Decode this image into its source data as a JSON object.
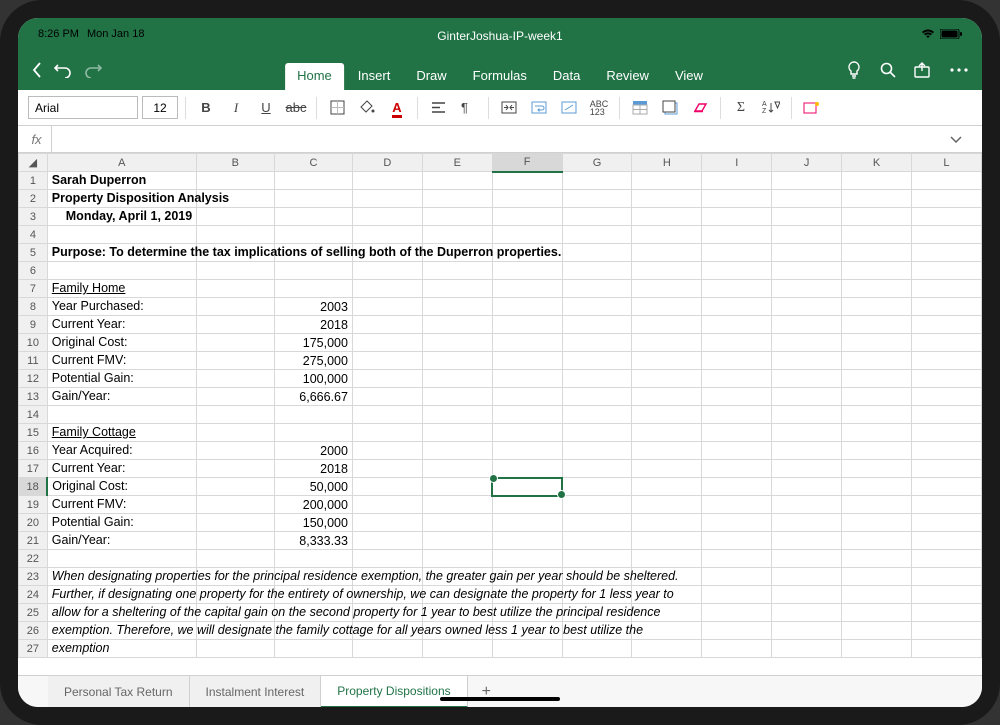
{
  "status": {
    "time": "8:26 PM",
    "date": "Mon Jan 18"
  },
  "file_title": "GinterJoshua-IP-week1",
  "ribbon": {
    "tabs": [
      "Home",
      "Insert",
      "Draw",
      "Formulas",
      "Data",
      "Review",
      "View"
    ],
    "active_index": 0
  },
  "toolbar": {
    "font_name": "Arial",
    "font_size": "12"
  },
  "formula": {
    "fx": "fx",
    "value": ""
  },
  "columns": [
    "A",
    "B",
    "C",
    "D",
    "E",
    "F",
    "G",
    "H",
    "I",
    "J",
    "K",
    "L"
  ],
  "active_col": "F",
  "active_row": 18,
  "rows": {
    "1": {
      "A": "Sarah Duperron",
      "bold": true
    },
    "2": {
      "A": "Property Disposition Analysis",
      "bold": true
    },
    "3": {
      "A_text": "Monday, April 1, 2019",
      "A_indent": true,
      "bold": true
    },
    "5": {
      "A": "Purpose: To determine the tax implications of selling both of the Duperron properties.",
      "bold": true
    },
    "7": {
      "A": "Family Home",
      "underline": true
    },
    "8": {
      "A": "Year Purchased:",
      "C": "2003"
    },
    "9": {
      "A": "Current Year:",
      "C": "2018"
    },
    "10": {
      "A": "Original Cost:",
      "C": "175,000"
    },
    "11": {
      "A": "Current FMV:",
      "C": "275,000"
    },
    "12": {
      "A": "Potential Gain:",
      "C": "100,000"
    },
    "13": {
      "A": "Gain/Year:",
      "C": "6,666.67"
    },
    "15": {
      "A": "Family Cottage",
      "underline": true
    },
    "16": {
      "A": "Year Acquired:",
      "C": "2000"
    },
    "17": {
      "A": "Current Year:",
      "C": "2018"
    },
    "18": {
      "A": "Original Cost:",
      "C": "50,000"
    },
    "19": {
      "A": "Current FMV:",
      "C": "200,000"
    },
    "20": {
      "A": "Potential Gain:",
      "C": "150,000"
    },
    "21": {
      "A": "Gain/Year:",
      "C": "8,333.33"
    },
    "23": {
      "A": "When designating properties for the principal residence exemption, the greater gain per year should be sheltered.",
      "italic": true
    },
    "24": {
      "A": "Further, if designating one property for the entirety of ownership, we can designate the property for 1 less year to",
      "italic": true
    },
    "25": {
      "A": "allow for a sheltering of the capital gain on the second property for 1 year to best utilize the principal residence",
      "italic": true
    },
    "26": {
      "A": "exemption. Therefore, we will designate the family cottage for all years owned less 1 year to best utilize the",
      "italic": true
    },
    "27": {
      "A": "exemption",
      "italic": true
    }
  },
  "sheet_tabs": {
    "items": [
      "Personal Tax Return",
      "Instalment Interest",
      "Property Dispositions"
    ],
    "active_index": 2,
    "add": "+"
  }
}
